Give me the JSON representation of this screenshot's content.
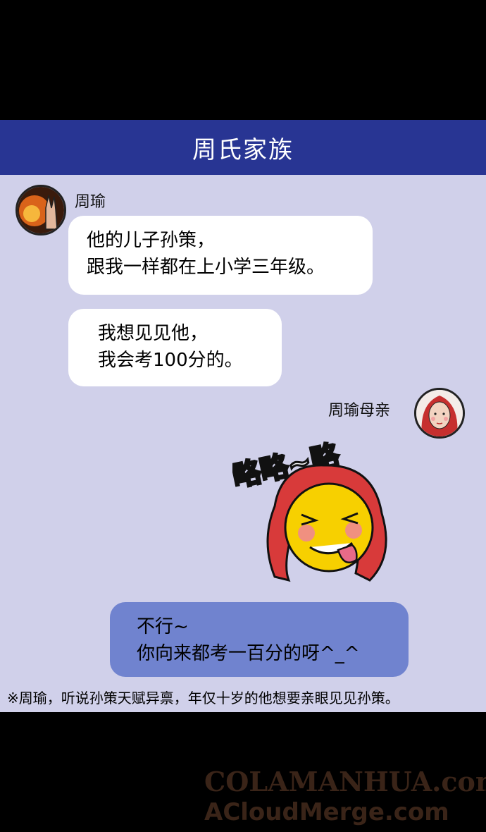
{
  "chat": {
    "title": "周氏家族",
    "zhouyu_name": "周瑜",
    "mother_name": "周瑜母亲",
    "messages": [
      {
        "line1": "他的儿子孙策，",
        "line2": "跟我一样都在上小学三年级。"
      },
      {
        "line1": "我想见见他，",
        "line2": "我会考100分的。"
      },
      {
        "line1": "不行~",
        "line2": "你向来都考一百分的呀^_^"
      }
    ],
    "sticker_text": "略略~略",
    "footnote": "※周瑜，听说孙策天赋异禀，年仅十岁的他想要亲眼见见孙策。"
  },
  "watermark": {
    "line1": "COLAMANHUA.com",
    "line2": "ACloudMerge.com"
  },
  "colors": {
    "header": "#283593",
    "panel": "#d0d0ea",
    "reply_bubble": "#7083cf"
  }
}
